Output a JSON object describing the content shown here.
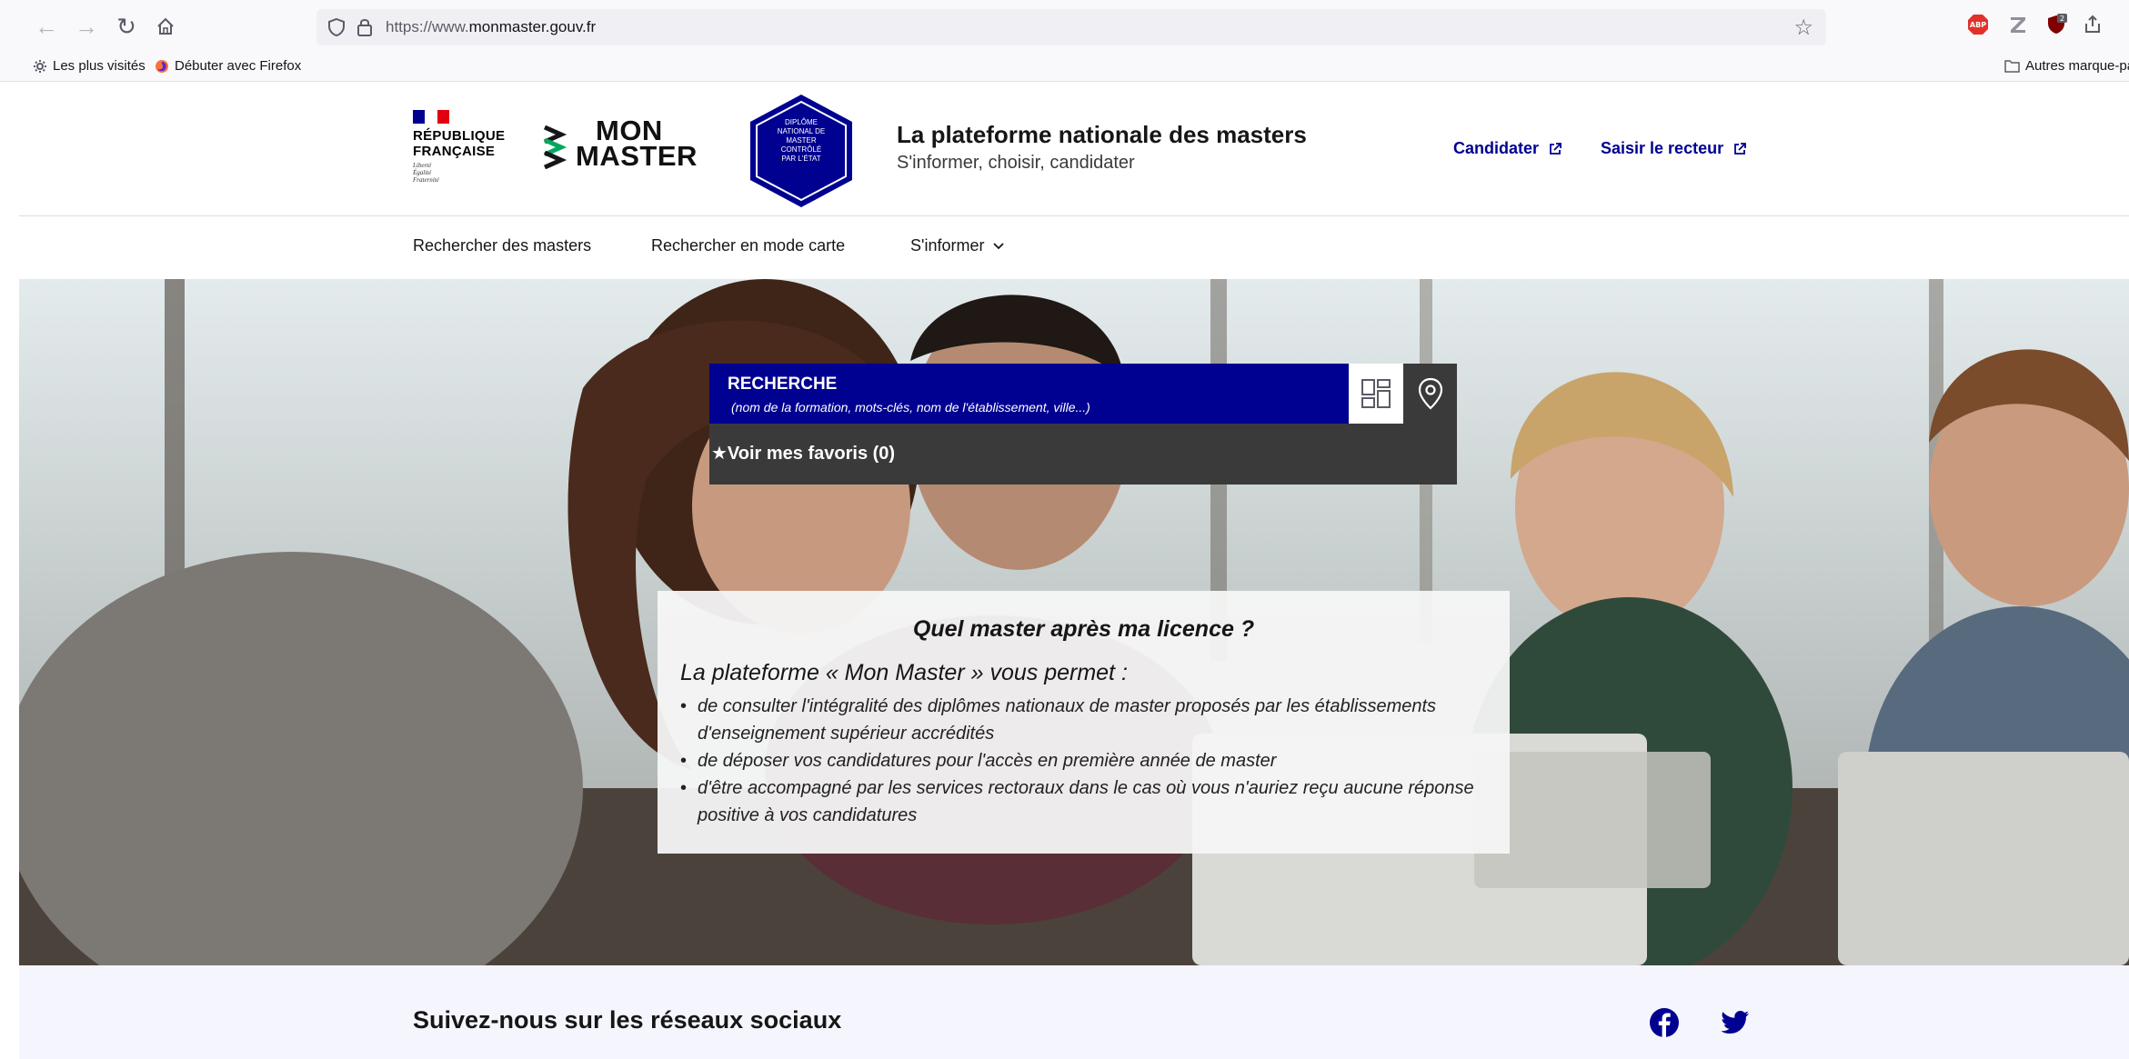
{
  "browser": {
    "url_prefix": "https://www.",
    "url_domain": "monmaster.gouv.fr",
    "bookmarks": [
      {
        "label": "Les plus visités",
        "icon": "gear-icon"
      },
      {
        "label": "Débuter avec Firefox",
        "icon": "firefox-icon"
      }
    ],
    "other_bookmarks": "Autres marque-pa",
    "extension_badge": "2"
  },
  "header": {
    "republic_name_line1": "RÉPUBLIQUE",
    "republic_name_line2": "FRANÇAISE",
    "motto_line1": "Liberté",
    "motto_line2": "Égalité",
    "motto_line3": "Fraternité",
    "logo_word1": "MON",
    "logo_word2": "MASTER",
    "seal_lines": [
      "DIPLÔME",
      "NATIONAL DE",
      "MASTER",
      "CONTRÔLÉ",
      "PAR L'ÉTAT"
    ],
    "title": "La plateforme nationale des masters",
    "tagline": "S'informer, choisir, candidater",
    "links": [
      "Candidater",
      "Saisir le recteur"
    ]
  },
  "nav": {
    "items": [
      "Rechercher des masters",
      "Rechercher en mode carte",
      "S'informer"
    ]
  },
  "search": {
    "label": "RECHERCHE",
    "hint": "(nom de la formation, mots-clés, nom de l'établissement, ville...)",
    "favorites": "★Voir mes favoris (0)"
  },
  "info": {
    "question": "Quel master après ma licence ?",
    "lead": "La plateforme « Mon Master » vous permet :",
    "bullets": [
      "de consulter l'intégralité des diplômes nationaux de master proposés par les établissements d'enseignement supérieur accrédités",
      "de déposer vos candidatures pour l'accès en première année de master",
      "d'être accompagné par les services rectoraux dans le cas où vous n'auriez reçu aucune réponse positive à vos candidatures"
    ]
  },
  "footer": {
    "follow_title": "Suivez-nous sur les réseaux sociaux",
    "social": [
      "facebook-icon",
      "twitter-icon"
    ]
  },
  "colors": {
    "primary_blue": "#000091",
    "dark_panel": "#3a3a3a",
    "flag_red": "#e1000f",
    "follow_band": "#f5f5fe"
  }
}
